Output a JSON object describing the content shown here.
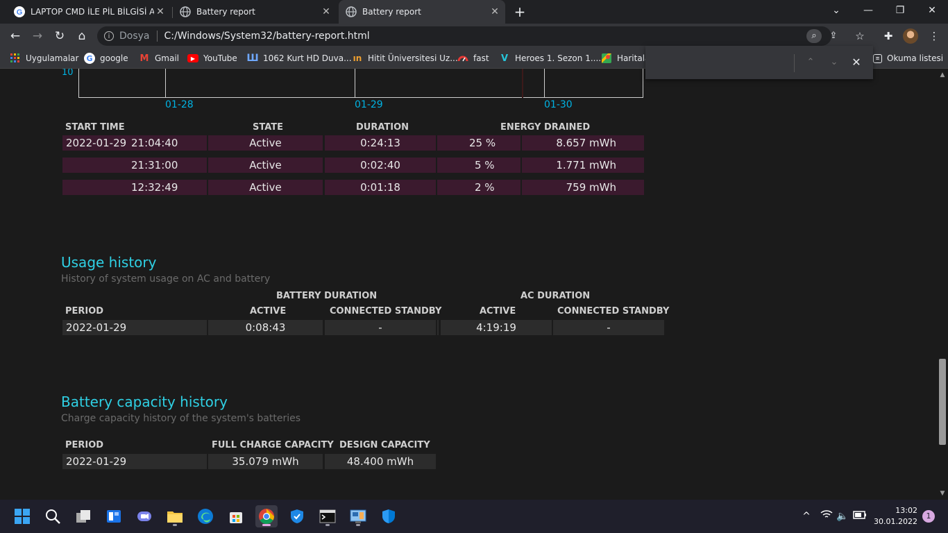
{
  "browser": {
    "tabs": [
      {
        "label": "LAPTOP CMD İLE PİL BİLGİSİ ALM",
        "icon": "google-g-icon",
        "active": false
      },
      {
        "label": "Battery report",
        "icon": "globe-icon",
        "active": false
      },
      {
        "label": "Battery report",
        "icon": "globe-icon",
        "active": true
      }
    ],
    "tab_close_glyph": "✕",
    "new_tab_glyph": "+",
    "address": {
      "scheme_label": "Dosya",
      "url": "C:/Windows/System32/battery-report.html"
    },
    "bookmarks": [
      {
        "label": "Uygulamalar",
        "icon": "apps-grid-icon"
      },
      {
        "label": "google",
        "icon": "google-g-icon"
      },
      {
        "label": "Gmail",
        "icon": "gmail-icon"
      },
      {
        "label": "YouTube",
        "icon": "youtube-icon"
      },
      {
        "label": "1062 Kurt HD Duva...",
        "icon": "bookmark-site-icon"
      },
      {
        "label": "Hitit Üniversitesi Uz...",
        "icon": "university-icon"
      },
      {
        "label": "fast",
        "icon": "speedometer-icon"
      },
      {
        "label": "Heroes 1. Sezon 1....",
        "icon": "play-v-icon"
      },
      {
        "label": "Haritala",
        "icon": "maps-icon"
      }
    ],
    "reading_list_label": "Okuma listesi"
  },
  "report": {
    "chart": {
      "y_tick": "10",
      "x_ticks": [
        "01-28",
        "01-29",
        "01-30"
      ]
    },
    "drain_table": {
      "headers": [
        "START TIME",
        "STATE",
        "DURATION",
        "ENERGY DRAINED"
      ],
      "rows": [
        {
          "date": "2022-01-29",
          "time": "21:04:40",
          "state": "Active",
          "duration": "0:24:13",
          "percent": "25 %",
          "energy": "8.657 mWh"
        },
        {
          "date": "",
          "time": "21:31:00",
          "state": "Active",
          "duration": "0:02:40",
          "percent": "5 %",
          "energy": "1.771 mWh"
        },
        {
          "date": "",
          "time": "12:32:49",
          "state": "Active",
          "duration": "0:01:18",
          "percent": "2 %",
          "energy": "759 mWh"
        }
      ]
    },
    "usage_history": {
      "title": "Usage history",
      "subtitle": "History of system usage on AC and battery",
      "group_headers": [
        "BATTERY DURATION",
        "AC DURATION"
      ],
      "headers": [
        "PERIOD",
        "ACTIVE",
        "CONNECTED STANDBY",
        "ACTIVE",
        "CONNECTED STANDBY"
      ],
      "row": {
        "period": "2022-01-29",
        "bat_active": "0:08:43",
        "bat_standby": "-",
        "ac_active": "4:19:19",
        "ac_standby": "-"
      }
    },
    "capacity_history": {
      "title": "Battery capacity history",
      "subtitle": "Charge capacity history of the system's batteries",
      "headers": [
        "PERIOD",
        "FULL CHARGE CAPACITY",
        "DESIGN CAPACITY"
      ],
      "row": {
        "period": "2022-01-29",
        "full": "35.079 mWh",
        "design": "48.400 mWh"
      }
    }
  },
  "taskbar": {
    "time": "13:02",
    "date": "30.01.2022",
    "notification_count": "1"
  },
  "colors": {
    "accent": "#2fd0e4",
    "chart_label": "#00b3e3",
    "row_pink": "#3b1a2e",
    "row_gray": "#2c2c2c"
  }
}
